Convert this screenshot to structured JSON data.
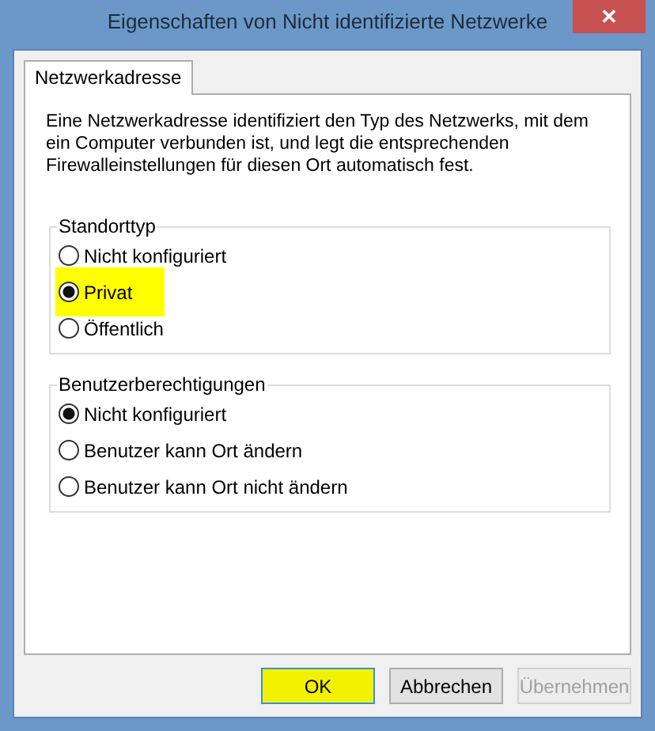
{
  "window": {
    "title": "Eigenschaften von Nicht identifizierte Netzwerke",
    "close": "✕"
  },
  "tabs": [
    {
      "label": "Netzwerkadresse",
      "selected": true
    }
  ],
  "description": "Eine Netzwerkadresse identifiziert den Typ des Netzwerks, mit dem ein Computer verbunden ist, und legt die entsprechenden Firewalleinstellungen für diesen Ort automatisch fest.",
  "groups": [
    {
      "title": "Standorttyp",
      "options": [
        {
          "label": "Nicht konfiguriert",
          "selected": false,
          "highlighted": false
        },
        {
          "label": "Privat",
          "selected": true,
          "highlighted": true
        },
        {
          "label": "Öffentlich",
          "selected": false,
          "highlighted": false
        }
      ]
    },
    {
      "title": "Benutzerberechtigungen",
      "options": [
        {
          "label": "Nicht konfiguriert",
          "selected": true,
          "highlighted": false
        },
        {
          "label": "Benutzer kann Ort ändern",
          "selected": false,
          "highlighted": false
        },
        {
          "label": "Benutzer kann Ort nicht ändern",
          "selected": false,
          "highlighted": false
        }
      ]
    }
  ],
  "buttons": [
    {
      "label": "OK",
      "disabled": false,
      "highlighted": true
    },
    {
      "label": "Abbrechen",
      "disabled": false,
      "highlighted": false
    },
    {
      "label": "Übernehmen",
      "disabled": true,
      "highlighted": false
    }
  ]
}
